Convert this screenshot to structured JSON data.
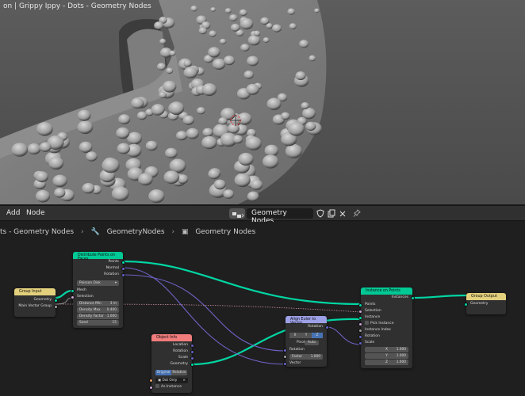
{
  "window": {
    "title": "on | Grippy Ippy - Dots - Geometry Nodes"
  },
  "header": {
    "menus": [
      "Add",
      "Node"
    ],
    "node_tree_name": "Geometry Nodes"
  },
  "breadcrumb": [
    "ts - Geometry Nodes",
    "GeometryNodes",
    "Geometry Nodes"
  ],
  "nodes": {
    "group_input": {
      "title": "Group Input",
      "outputs": [
        "Geometry",
        "Main Vector Group"
      ]
    },
    "distribute": {
      "title": "Distribute Points on Faces",
      "outputs": [
        "Points",
        "Normal",
        "Rotation"
      ],
      "mode": "Poisson Disk",
      "inputs": [
        "Mesh",
        "Selection"
      ],
      "fields": [
        {
          "label": "Distance Min",
          "value": "3 m"
        },
        {
          "label": "Density Max",
          "value": "0.400"
        },
        {
          "label": "Density Factor",
          "value": "1.000"
        },
        {
          "label": "Seed",
          "value": "15"
        }
      ]
    },
    "object_info": {
      "title": "Object Info",
      "outputs": [
        "Location",
        "Rotation",
        "Scale",
        "Geometry"
      ],
      "modes": [
        "Original",
        "Relative"
      ],
      "object": "Dot Only",
      "as_instance": "As Instance"
    },
    "align": {
      "title": "Align Euler to Vector",
      "output": "Rotation",
      "axes": [
        "X",
        "Y",
        "Z"
      ],
      "pivot_label": "Pivot",
      "pivot_value": "Auto",
      "inputs": [
        "Rotation",
        "Vector"
      ],
      "factor_label": "Factor",
      "factor_value": "1.000"
    },
    "instance": {
      "title": "Instance on Points",
      "output": "Instances",
      "inputs": [
        "Points",
        "Selection",
        "Instance",
        "Pick Instance",
        "Instance Index",
        "Rotation",
        "Scale"
      ],
      "scale": [
        {
          "label": "X",
          "value": "1.000"
        },
        {
          "label": "Y",
          "value": "1.000"
        },
        {
          "label": "Z",
          "value": "1.000"
        }
      ]
    },
    "group_output": {
      "title": "Group Output",
      "inputs": [
        "Geometry"
      ]
    }
  },
  "colors": {
    "geometry_socket": "#00d6a3",
    "vector_socket": "#6363c7",
    "float_socket": "#a1a1a1",
    "group_header": "#e3d07c",
    "geometry_header": "#00c995",
    "vector_header": "#9da0e6",
    "input_header": "#f07c7c"
  }
}
